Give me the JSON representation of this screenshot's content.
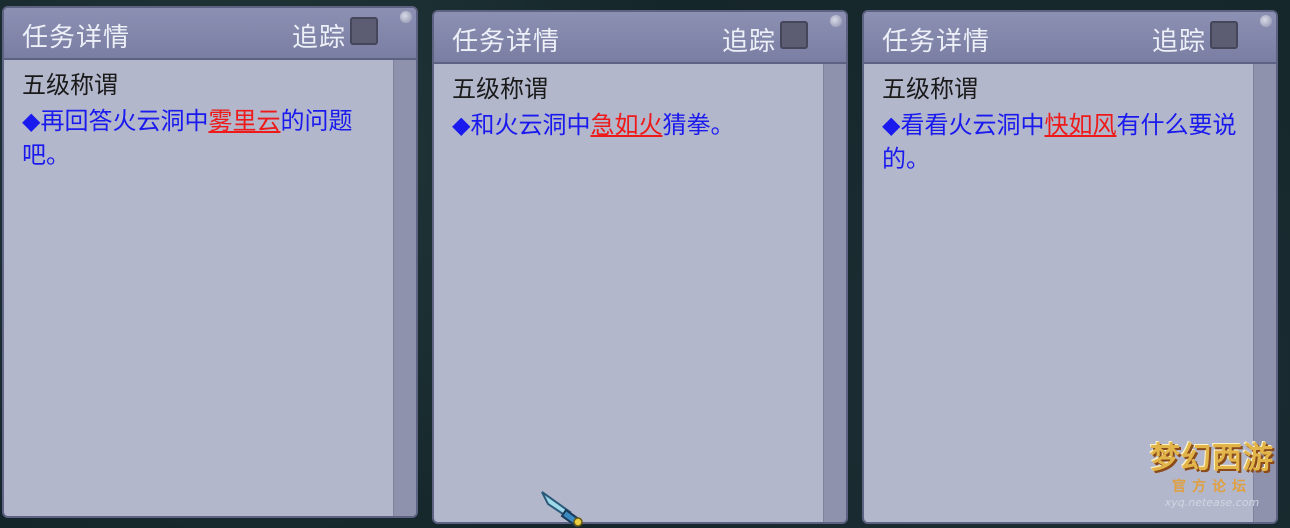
{
  "panels": [
    {
      "title": "任务详情",
      "track_label": "追踪",
      "task_name": "五级称谓",
      "desc_prefix": "◆再回答火云洞中",
      "npc": "雾里云",
      "desc_suffix": "的问题吧。"
    },
    {
      "title": "任务详情",
      "track_label": "追踪",
      "task_name": "五级称谓",
      "desc_prefix": "◆和火云洞中",
      "npc": "急如火",
      "desc_suffix": "猜拳。"
    },
    {
      "title": "任务详情",
      "track_label": "追踪",
      "task_name": "五级称谓",
      "desc_prefix": "◆看看火云洞中",
      "npc": "快如风",
      "desc_suffix": "有什么要说的。"
    }
  ],
  "watermark": {
    "logo": "梦幻西游",
    "sub": "官方论坛",
    "url": "xyq.netease.com"
  },
  "colors": {
    "panel_bg": "#b3b7cc",
    "titlebar": "#7a7ea2",
    "desc_text": "#1a1aee",
    "npc_text": "#ee1a1a"
  },
  "icons": {
    "track_checkbox": "checkbox-icon",
    "cursor": "sword-cursor-icon"
  }
}
